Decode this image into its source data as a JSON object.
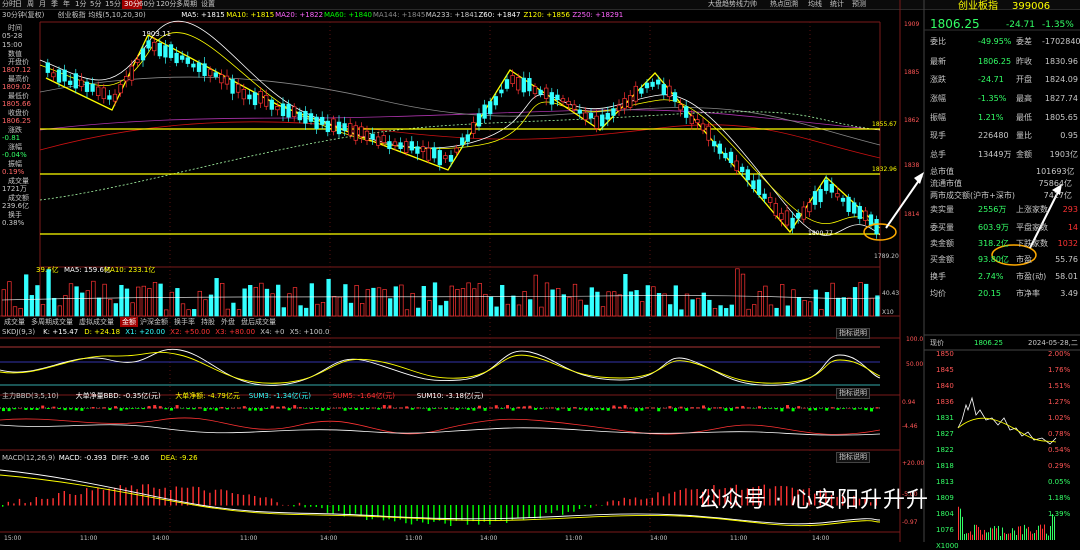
{
  "toolbar": {
    "items": [
      "分时",
      "日",
      "周",
      "月",
      "季",
      "年",
      "1分",
      "5分",
      "15分",
      "30分",
      "60分",
      "120分",
      "多周期",
      "设置"
    ],
    "active_index": 9,
    "right_items": [
      "大盘趋势线力帅",
      "热点回溯",
      "均线",
      "统计",
      "预测"
    ]
  },
  "info": {
    "period": "30分钟(复权)",
    "name": "创业板指",
    "ma_text": "均线(5,10,20,30)",
    "ma5": "MA5: +1815",
    "ma10": "MA10: +1815",
    "ma20": "MA20: +1822",
    "ma60": "MA60: +1840",
    "ma144": "MA144: +1845",
    "ma233": "MA233: +1841",
    "z60": "Z60: +1847",
    "z120": "Z120: +1856",
    "z250": "Z250: +18291"
  },
  "left_panel": [
    {
      "label": "时间",
      "value": "05-28"
    },
    {
      "label": "",
      "value": "15:00"
    },
    {
      "label": "数值",
      "value": ""
    },
    {
      "label": "开盘价",
      "value": "1807.12"
    },
    {
      "label": "最高价",
      "value": "1809.02"
    },
    {
      "label": "最低价",
      "value": "1805.66"
    },
    {
      "label": "收盘价",
      "value": "1806.25"
    },
    {
      "label": "涨跌",
      "value": "-0.81"
    },
    {
      "label": "涨幅",
      "value": "-0.04%"
    },
    {
      "label": "振幅",
      "value": "0.19%"
    },
    {
      "label": "成交量",
      "value": "1721万"
    },
    {
      "label": "成交额",
      "value": "239.6亿"
    },
    {
      "label": "换手",
      "value": "0.38%"
    }
  ],
  "price_axis": [
    "1909",
    "1885",
    "1862",
    "1838",
    "1814"
  ],
  "price_annotations": {
    "high": "1903.11",
    "line1": "1855.67",
    "line2": "1832.96",
    "low_mark": "1800.77",
    "bottom": "1789.20"
  },
  "volume": {
    "label": "39.6亿",
    "ma5": "MA5: 159.6亿",
    "ma10": "MA10: 233.1亿",
    "axis": [
      "X10",
      "40.43"
    ]
  },
  "tabs": [
    "成交量",
    "多周期成交量",
    "虚拟成交量",
    "金额",
    "沪深金额",
    "换手率",
    "持股",
    "外盘",
    "盘后成交量"
  ],
  "tab_active": 3,
  "indicator_btn": "指标说明",
  "skdj": {
    "label": "SKDJ(9,3)",
    "k": "K: +15.47",
    "d": "D: +24.18",
    "x1": "X1: +20.00",
    "x2": "X2: +50.00",
    "x3": "X3: +80.00",
    "x4": "X4: +0",
    "x5": "X5: +100.0",
    "axis": [
      "100.0",
      "50.00"
    ]
  },
  "bbd": {
    "label": "主力BBD(3,5,10)",
    "big": "大单净量BBD: -0.35亿(元)",
    "big2": "大单净额: -4.79亿元",
    "sum3": "SUM3: -1.34亿(元)",
    "sum5": "SUM5: -1.64亿(元)",
    "sum10": "SUM10: -3.18亿(元)",
    "axis": [
      "0.94",
      "-4.46"
    ]
  },
  "macd": {
    "label": "MACD(12,26,9)",
    "macd": "MACD: -0.393",
    "diff": "DIFF: -9.06",
    "dea": "DEA: -9.26",
    "axis": [
      "+20.00",
      "-5.00",
      "-0.97"
    ]
  },
  "time_axis": [
    "15:00",
    "11:00",
    "14:00",
    "11:00",
    "14:00",
    "11:00",
    "14:00",
    "11:00",
    "14:00",
    "11:00",
    "14:00"
  ],
  "right": {
    "title": "创业板指",
    "code": "399006",
    "price": "1806.25",
    "change": "-24.71",
    "pct": "-1.35%",
    "rows": [
      {
        "l": "委比",
        "v": "-49.95%",
        "l2": "委差",
        "v2": "-17028401"
      },
      {
        "l": "最新",
        "v": "1806.25",
        "l2": "昨收",
        "v2": "1830.96"
      },
      {
        "l": "涨跌",
        "v": "-24.71",
        "l2": "开盘",
        "v2": "1824.09"
      },
      {
        "l": "涨幅",
        "v": "-1.35%",
        "l2": "最高",
        "v2": "1827.74"
      },
      {
        "l": "振幅",
        "v": "1.21%",
        "l2": "最低",
        "v2": "1805.65"
      },
      {
        "l": "现手",
        "v": "226480",
        "l2": "量比",
        "v2": "0.95"
      },
      {
        "l": "总手",
        "v": "13449万",
        "l2": "金额",
        "v2": "1903亿"
      },
      {
        "l": "总市值",
        "v": "",
        "l2": "",
        "v2": "101693亿"
      },
      {
        "l": "流通市值",
        "v": "",
        "l2": "",
        "v2": "75864亿"
      },
      {
        "l": "两市成交额(沪市+深市)",
        "v": "",
        "l2": "",
        "v2": "7417亿"
      },
      {
        "l": "卖实量",
        "v": "2556万",
        "l2": "上涨家数",
        "v2": "293"
      },
      {
        "l": "委买量",
        "v": "603.9万",
        "l2": "平盘家数",
        "v2": "14"
      },
      {
        "l": "卖金额",
        "v": "318.2亿",
        "l2": "下跌家数",
        "v2": "1032"
      },
      {
        "l": "买金额",
        "v": "93.80亿",
        "l2": "市盈",
        "v2": "55.76"
      },
      {
        "l": "换手",
        "v": "2.74%",
        "l2": "市盈(动)",
        "v2": "58.01"
      },
      {
        "l": "均价",
        "v": "20.15",
        "l2": "市净率",
        "v2": "3.49"
      }
    ],
    "mini_header": {
      "label": "现价",
      "price": "1806.25",
      "date": "2024-05-28,二"
    },
    "mini_axis_left": [
      "1850",
      "1845",
      "1840",
      "1836",
      "1831",
      "1827",
      "1822",
      "1818",
      "1813",
      "1809",
      "1804",
      "1076",
      "X1000"
    ],
    "mini_axis_right": [
      "2.00%",
      "1.76%",
      "1.51%",
      "1.27%",
      "1.02%",
      "0.78%",
      "0.54%",
      "0.29%",
      "0.05%",
      "1.18%",
      "1.39%"
    ]
  },
  "watermark": "公众号 · 心安阳升升升",
  "colors": {
    "up": "#ff3333",
    "down": "#33ffff",
    "yellow": "#ffff00",
    "bg": "#000000",
    "grid": "#7a1a1a"
  }
}
